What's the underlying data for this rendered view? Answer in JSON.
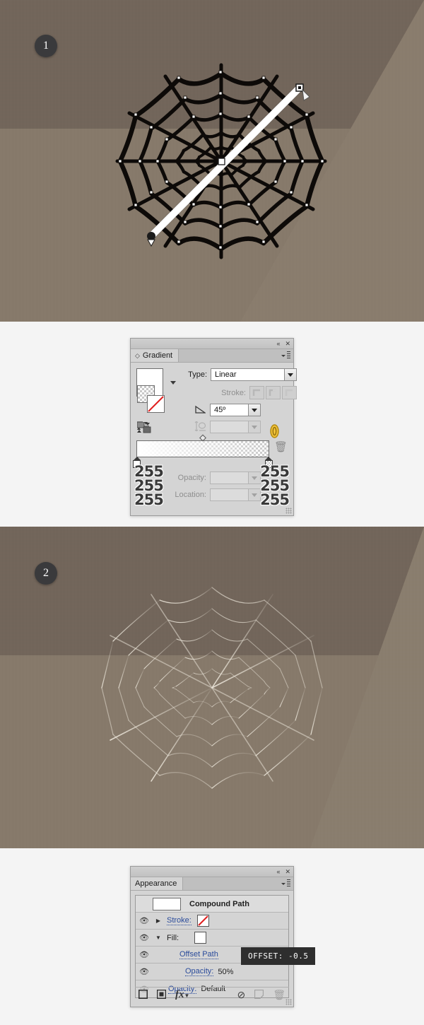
{
  "artboards": [
    {
      "step": "1",
      "caption_color": "#3a3a3c"
    },
    {
      "step": "2",
      "caption_color": "#3a3a3c"
    }
  ],
  "canvas": {
    "bg_dark": "#72655a",
    "bg_base": "#796c5d",
    "bg_light": "#877a6a",
    "bg_diagonal": "#8a7d6d",
    "web_stroke_dark": "#0d0a08",
    "web_stroke_light": "#d8d2c6",
    "gradient_annotator_color": "#ffffff"
  },
  "gradient_panel": {
    "tab_label": "Gradient",
    "collapse_icon": "«",
    "close_icon": "✕",
    "menu_icon": "panel-menu-icon",
    "type_label": "Type:",
    "type_value": "Linear",
    "stroke_label": "Stroke:",
    "stroke_options": [
      "within-stroke",
      "along-stroke",
      "across-stroke"
    ],
    "angle_label": "angle-icon",
    "angle_value": "45º",
    "aspect_label": "aspect-ratio-icon",
    "aspect_value": "",
    "reverse_label": "reverse-gradient-icon",
    "opacity_label": "Opacity:",
    "opacity_value": "",
    "location_label": "Location:",
    "location_value": "",
    "delete_label": "delete-stop-icon",
    "stops": [
      {
        "position": "0%",
        "rgb": [
          "255",
          "255",
          "255"
        ],
        "alpha": "100"
      },
      {
        "position": "100%",
        "rgb": [
          "255",
          "255",
          "255"
        ],
        "alpha": "0"
      }
    ]
  },
  "appearance_panel": {
    "tab_label": "Appearance",
    "collapse_icon": "«",
    "close_icon": "✕",
    "object_type": "Compound Path",
    "rows": [
      {
        "name": "stroke-row",
        "label": "Stroke:",
        "value": "",
        "visible": true,
        "expandable": "collapsed",
        "swatch": "none"
      },
      {
        "name": "fill-row",
        "label": "Fill:",
        "value": "",
        "visible": true,
        "expandable": "expanded",
        "swatch": "gradient"
      },
      {
        "name": "offset-path-row",
        "label": "Offset Path",
        "value": "",
        "visible": true,
        "expandable": "none",
        "swatch": ""
      },
      {
        "name": "fill-opacity-row",
        "label": "Opacity:",
        "value": "50%",
        "visible": true,
        "expandable": "none",
        "swatch": ""
      },
      {
        "name": "object-opacity-row",
        "label": "Opacity:",
        "value": "Default",
        "visible": false,
        "expandable": "none",
        "swatch": ""
      }
    ],
    "footer_icons": [
      "add-new-stroke-icon",
      "add-new-fill-icon",
      "add-new-effect-icon",
      "clear-appearance-icon",
      "duplicate-item-icon",
      "delete-item-icon"
    ],
    "tooltip": "OFFSET: -0.5"
  }
}
